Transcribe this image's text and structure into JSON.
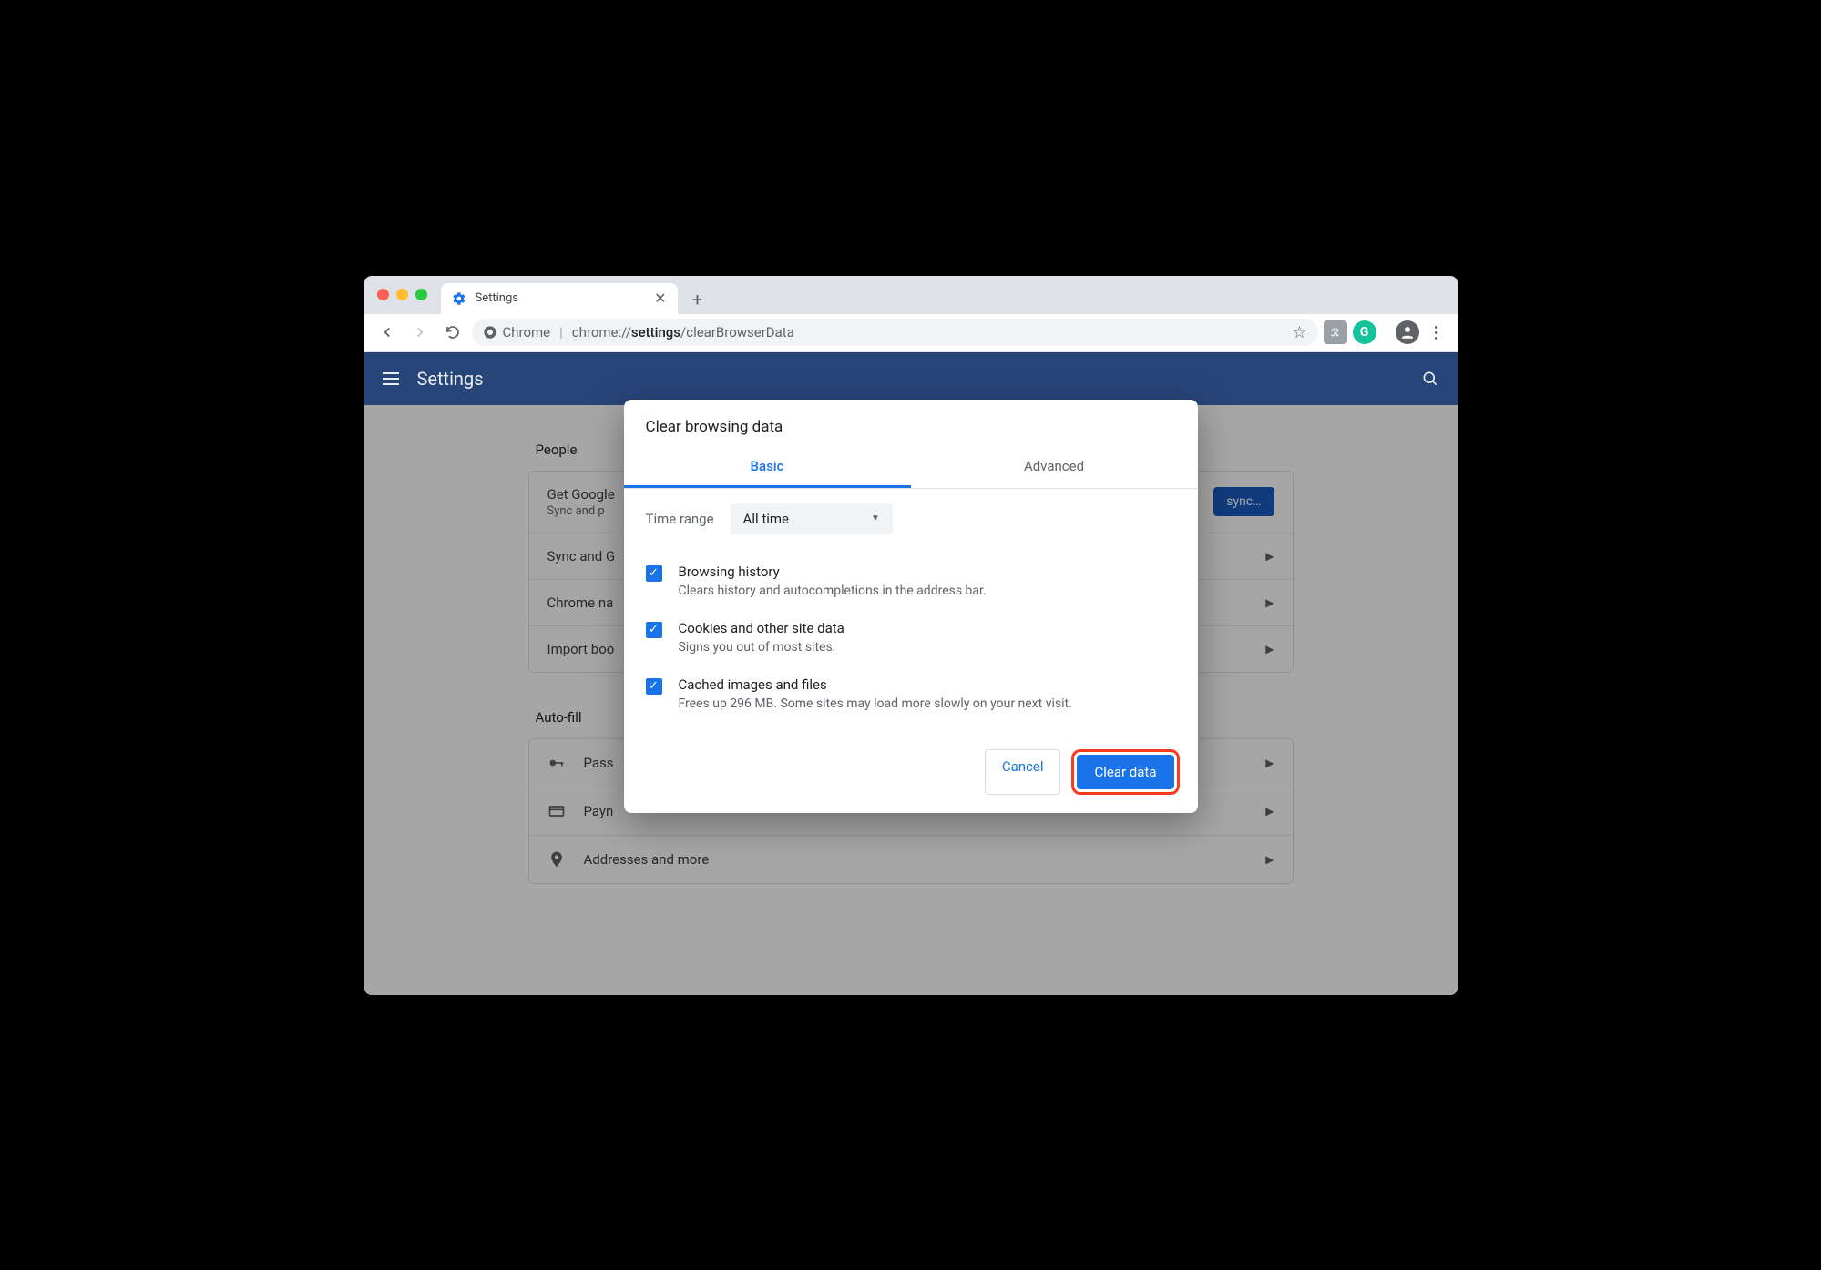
{
  "tab": {
    "title": "Settings"
  },
  "omnibox": {
    "scheme_label": "Chrome",
    "url_prefix": "chrome://",
    "url_bold": "settings",
    "url_suffix": "/clearBrowserData"
  },
  "appbar": {
    "title": "Settings"
  },
  "sections": {
    "people": {
      "title": "People",
      "row0_title": "Get Google",
      "row0_sub": "Sync and p",
      "sync_btn": "sync…",
      "row1": "Sync and G",
      "row2": "Chrome na",
      "row3": "Import boo"
    },
    "autofill": {
      "title": "Auto-fill",
      "row0": "Pass",
      "row1": "Payn",
      "row2": "Addresses and more"
    }
  },
  "dialog": {
    "title": "Clear browsing data",
    "tabs": {
      "basic": "Basic",
      "advanced": "Advanced"
    },
    "time_range_label": "Time range",
    "time_range_value": "All time",
    "items": [
      {
        "label": "Browsing history",
        "desc": "Clears history and autocompletions in the address bar."
      },
      {
        "label": "Cookies and other site data",
        "desc": "Signs you out of most sites."
      },
      {
        "label": "Cached images and files",
        "desc": "Frees up 296 MB. Some sites may load more slowly on your next visit."
      }
    ],
    "cancel": "Cancel",
    "confirm": "Clear data"
  }
}
